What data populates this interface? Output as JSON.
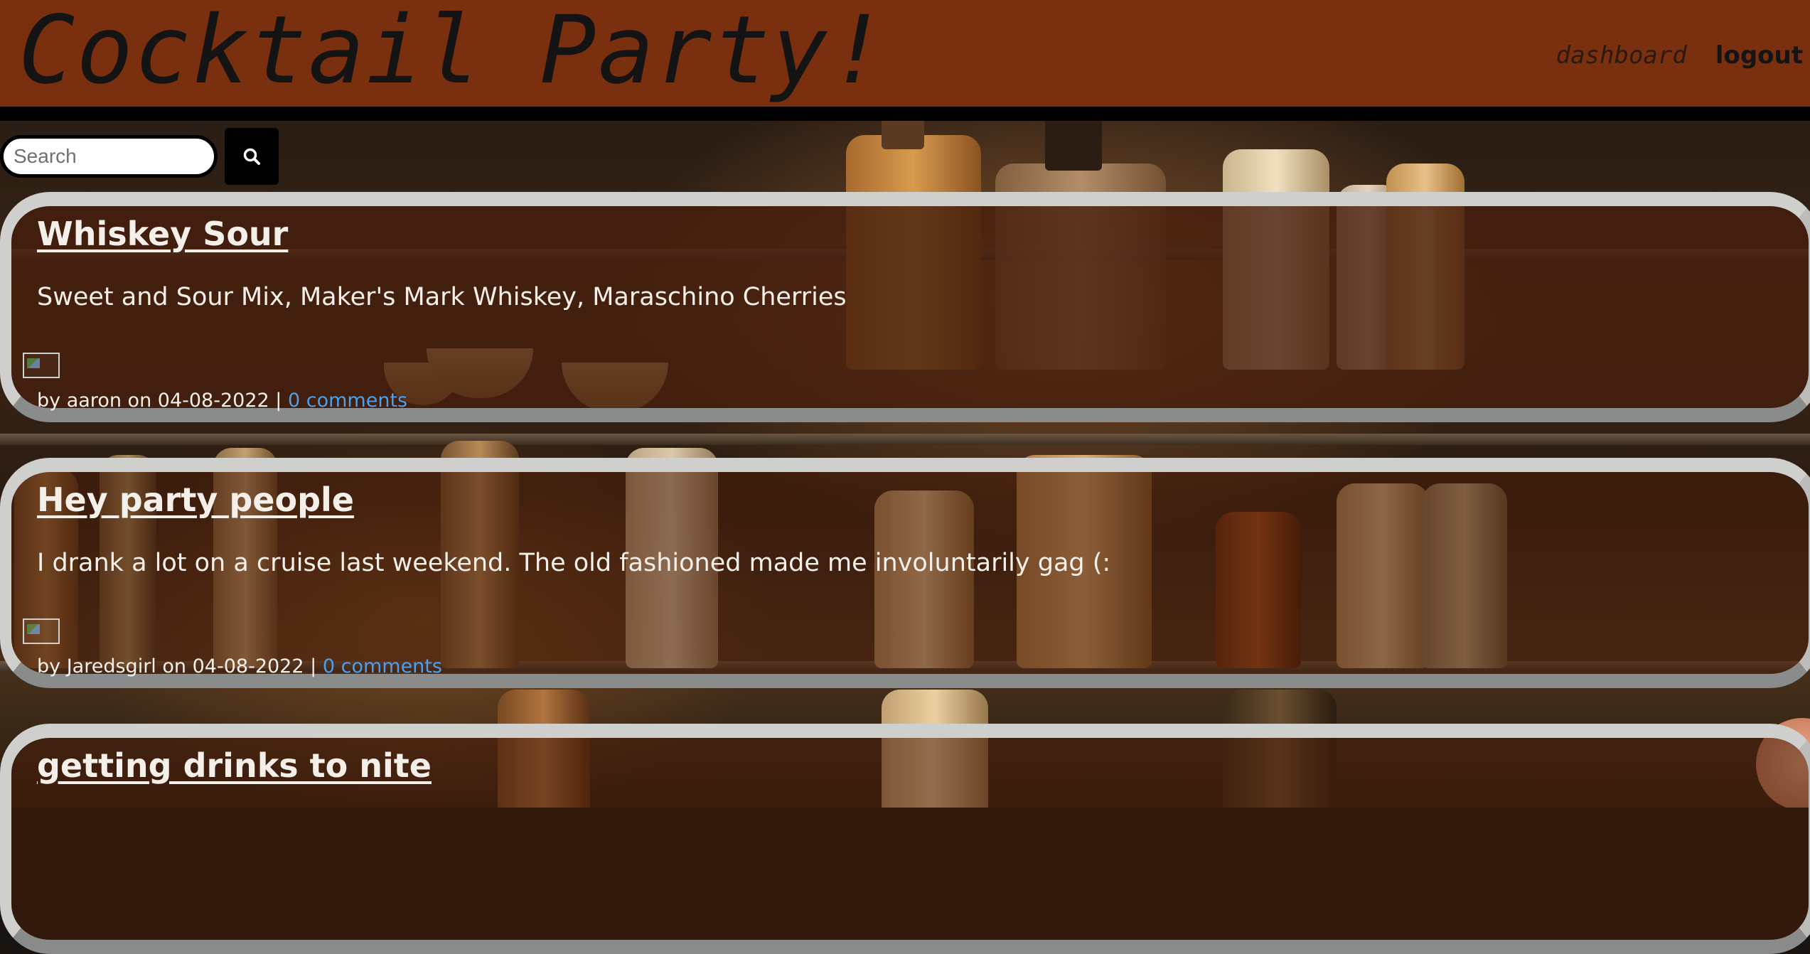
{
  "header": {
    "title": "Cocktail Party!",
    "nav": {
      "dashboard": "dashboard",
      "logout": "logout"
    }
  },
  "search": {
    "placeholder": "Search",
    "button_icon": "search-icon"
  },
  "posts": [
    {
      "title": "Whiskey Sour",
      "body": "Sweet and Sour Mix, Maker's Mark Whiskey, Maraschino Cherries",
      "author": "aaron",
      "date": "04-08-2022",
      "comments": "0 comments"
    },
    {
      "title": "Hey party people",
      "body": "I drank a lot on a cruise last weekend. The old fashioned made me involuntarily gag (:",
      "author": "Jaredsgirl",
      "date": "04-08-2022",
      "comments": "0 comments"
    },
    {
      "title": "getting drinks to nite",
      "body": "",
      "author": "",
      "date": "",
      "comments": ""
    }
  ],
  "labels": {
    "by": "by",
    "on": "on",
    "sep": "|"
  },
  "colors": {
    "header_bg": "#7a2f0f",
    "link": "#4aa0ee",
    "card_border": "#cfcfcd"
  }
}
